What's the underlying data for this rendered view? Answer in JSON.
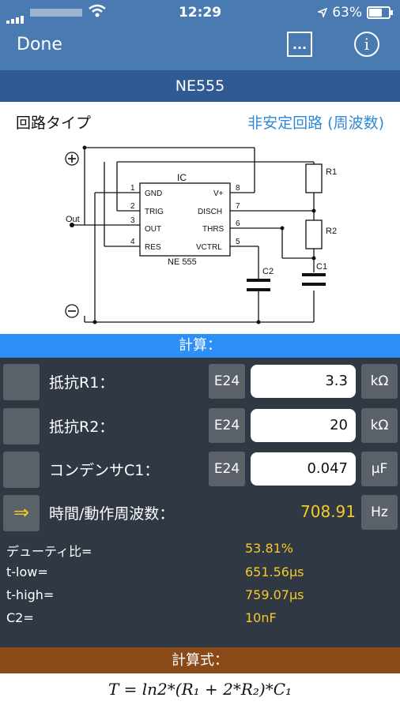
{
  "status": {
    "time": "12:29",
    "battery": "63%"
  },
  "nav": {
    "done": "Done",
    "info": "i",
    "dots": "..."
  },
  "title": "NE555",
  "circuit_type": {
    "label": "回路タイプ",
    "value": "非安定回路 (周波数)"
  },
  "diagram": {
    "ic_label": "IC",
    "ic_name": "NE 555",
    "pins": {
      "p1": "1",
      "p2": "2",
      "p3": "3",
      "p4": "4",
      "p5": "5",
      "p6": "6",
      "p7": "7",
      "p8": "8",
      "gnd": "GND",
      "trig": "TRIG",
      "out": "OUT",
      "res": "RES",
      "vplus": "V+",
      "disch": "DISCH",
      "thrs": "THRS",
      "vctrl": "VCTRL"
    },
    "r1": "R1",
    "r2": "R2",
    "c1": "C1",
    "c2": "C2",
    "out": "Out",
    "plus": "+",
    "minus": "−"
  },
  "calc_header": "計算：",
  "rows": [
    {
      "label": "抵抗R1：",
      "e24": "E24",
      "value": "3.3",
      "unit": "kΩ"
    },
    {
      "label": "抵抗R2：",
      "e24": "E24",
      "value": "20",
      "unit": "kΩ"
    },
    {
      "label": "コンデンサC1：",
      "e24": "E24",
      "value": "0.047",
      "unit": "µF"
    }
  ],
  "result": {
    "arrow": "⇒",
    "label": "時間/動作周波数：",
    "value": "708.91",
    "unit": "Hz"
  },
  "details": [
    {
      "label": "デューティ比=",
      "value": "53.81%"
    },
    {
      "label": "t-low=",
      "value": "651.56µs"
    },
    {
      "label": "t-high=",
      "value": "759.07µs"
    },
    {
      "label": "C2=",
      "value": "10nF"
    }
  ],
  "formula_header": "計算式：",
  "formula": "T = ln2*(R₁ + 2*R₂)*C₁"
}
